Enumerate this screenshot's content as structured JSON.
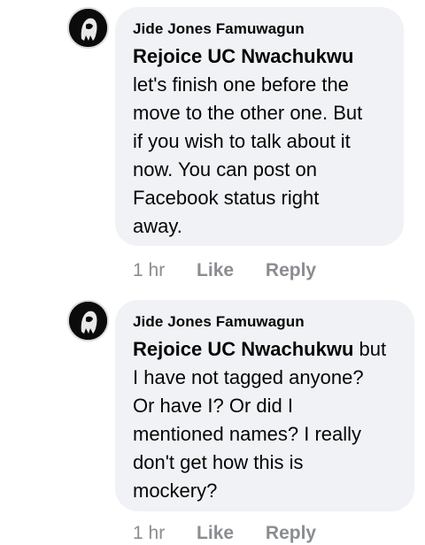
{
  "comments": [
    {
      "author": "Jide Jones Famuwagun",
      "mention": "Rejoice UC Nwachukwu",
      "text_lines": [
        "let's finish one before the",
        "move to the other one. But",
        "if you wish to talk about it",
        "now. You can post on",
        "Facebook status right",
        "away."
      ],
      "time": "1 hr",
      "like_label": "Like",
      "reply_label": "Reply"
    },
    {
      "author": "Jide Jones Famuwagun",
      "mention": "Rejoice UC Nwachukwu",
      "mention_suffix": " but",
      "text_lines": [
        "I have not tagged anyone?",
        "Or have I? Or did I",
        "mentioned names? I really",
        "don't get how this is",
        "mockery?"
      ],
      "time": "1 hr",
      "like_label": "Like",
      "reply_label": "Reply"
    }
  ],
  "colors": {
    "bubble_bg": "#f0f2f5",
    "meta_text": "#8a8d91",
    "text": "#050505"
  }
}
